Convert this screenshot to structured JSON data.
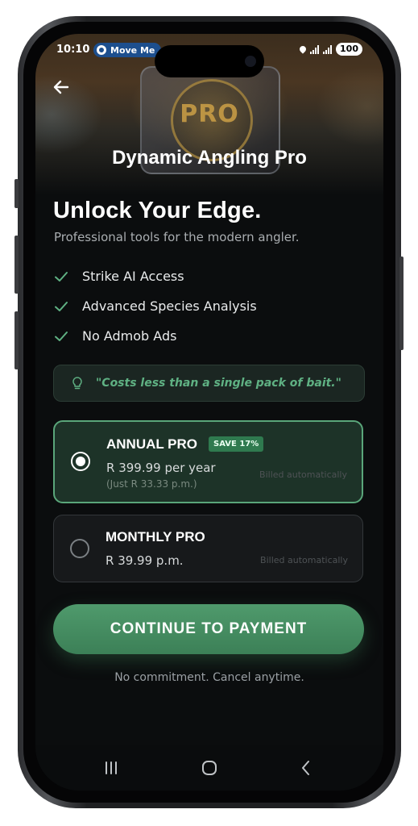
{
  "status_bar": {
    "time": "10:10",
    "notification_chip": "Move Me",
    "battery": "100"
  },
  "header": {
    "app_title": "Dynamic Angling Pro",
    "hero_badge_text": "PRO",
    "back_icon": "arrow-left-icon"
  },
  "intro": {
    "headline": "Unlock Your Edge.",
    "subheadline": "Professional tools for the modern angler."
  },
  "features": [
    {
      "label": "Strike AI Access",
      "icon": "check-icon"
    },
    {
      "label": "Advanced Species Analysis",
      "icon": "check-icon"
    },
    {
      "label": "No Admob Ads",
      "icon": "check-icon"
    }
  ],
  "quote": {
    "icon": "lightbulb-icon",
    "text": "\"Costs less than a single pack of bait.\""
  },
  "plans": {
    "annual": {
      "name": "ANNUAL PRO",
      "badge": "SAVE 17%",
      "price": "R 399.99 per year",
      "sub_price": "(Just R 33.33 p.m.)",
      "billing_note": "Billed automatically",
      "selected": true
    },
    "monthly": {
      "name": "MONTHLY PRO",
      "price": "R 39.99 p.m.",
      "billing_note": "Billed automatically",
      "selected": false
    }
  },
  "cta": {
    "label": "CONTINUE TO PAYMENT"
  },
  "footnote": "No commitment. Cancel anytime.",
  "nav": {
    "recents_icon": "recents-icon",
    "home_icon": "home-icon",
    "back_icon": "chevron-left-icon"
  },
  "colors": {
    "accent": "#4f9a6c",
    "accent_text": "#5fb183",
    "selected_border": "#5aa67a",
    "background": "#0b0d0e"
  }
}
